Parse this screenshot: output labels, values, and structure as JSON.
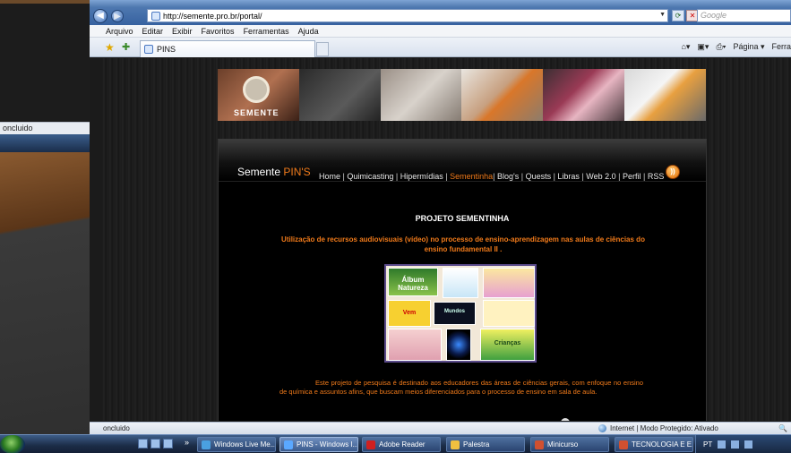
{
  "browser": {
    "url": "http://semente.pro.br/portal/",
    "search_placeholder": "Google",
    "menu": [
      "Arquivo",
      "Editar",
      "Exibir",
      "Favoritos",
      "Ferramentas",
      "Ajuda"
    ],
    "tab_title": "PINS",
    "commands": [
      "Página ▾",
      "Ferra"
    ]
  },
  "site": {
    "banner_logo": "SEMENTE",
    "brand_prefix": "Semente ",
    "brand_accent": "PIN'S",
    "nav": [
      {
        "label": "Home",
        "active": false
      },
      {
        "label": "Quimicasting",
        "active": false
      },
      {
        "label": "Hipermídias",
        "active": false
      },
      {
        "label": "Sementinha",
        "active": true
      },
      {
        "label": "Blog's",
        "active": false
      },
      {
        "label": "Quests",
        "active": false
      },
      {
        "label": "Libras",
        "active": false
      },
      {
        "label": "Web 2.0",
        "active": false
      },
      {
        "label": "Perfil",
        "active": false
      },
      {
        "label": "RSS",
        "active": false
      }
    ],
    "rss_icon": "rss-icon",
    "project_title": "PROJETO SEMENTINHA",
    "project_subtitle": "Utilização de recursos audiovisuais (vídeo) no processo de ensino-aprendizagem nas aulas de ciências do ensino fundamental II .",
    "collage_labels": [
      "Álbum Natureza",
      "Mundos",
      "Vem",
      "Crianças"
    ],
    "description": "Este projeto de pesquisa é destinado aos educadores das áreas de ciências gerais, com enfoque no ensino de química e assuntos afins, que buscam meios diferenciados para o processo de ensino em sala de aula.",
    "accent_color": "#f07a1a"
  },
  "desktop": {
    "thumb_status": "oncluido"
  },
  "status": {
    "left": "oncluido",
    "zone": "Internet | Modo Protegido: Ativado",
    "zoom": "🔍"
  },
  "taskbar": {
    "tasks": [
      {
        "label": "Windows Live Me...",
        "active": false
      },
      {
        "label": "PINS - Windows I...",
        "active": true
      },
      {
        "label": "Adobe Reader",
        "active": false
      },
      {
        "label": "Palestra",
        "active": false
      },
      {
        "label": "Minicurso",
        "active": false
      },
      {
        "label": "TECNOLOGIA E E...",
        "active": false
      }
    ],
    "language": "PT"
  }
}
